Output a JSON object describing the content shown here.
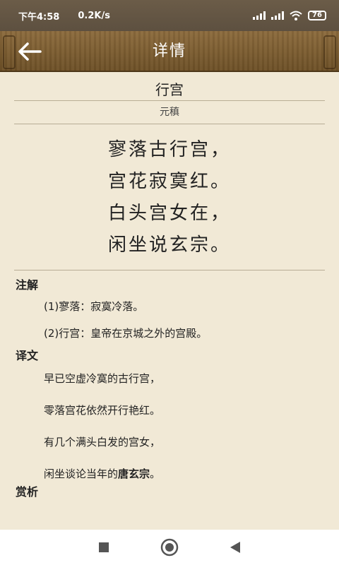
{
  "status_bar": {
    "time": "下午4:58",
    "speed": "0.2K/s",
    "battery": "76"
  },
  "header": {
    "title": "详情",
    "back_icon": "arrow-left-icon"
  },
  "poem": {
    "title": "行宫",
    "author": "元稹",
    "lines": [
      "寥落古行宫，",
      "宫花寂寞红。",
      "白头宫女在，",
      "闲坐说玄宗。"
    ]
  },
  "notes": {
    "heading": "注解",
    "items": [
      "(1)寥落：寂寞冷落。",
      "(2)行宫：皇帝在京城之外的宫殿。"
    ]
  },
  "translation": {
    "heading": "译文",
    "lines": [
      "早已空虚冷寞的古行宫，",
      "零落宫花依然开行艳红。",
      "有几个满头白发的宫女，"
    ],
    "last_line_prefix": "闲坐谈论当年的",
    "last_line_bold": "唐玄宗",
    "last_line_suffix": "。"
  },
  "appreciation": {
    "heading": "赏析"
  },
  "nav": {
    "icons": [
      "square-icon",
      "circle-icon",
      "triangle-back-icon"
    ]
  },
  "colors": {
    "background": "#f1e9d6",
    "header_wood": "#7d5e32",
    "status_bar": "#635443"
  }
}
